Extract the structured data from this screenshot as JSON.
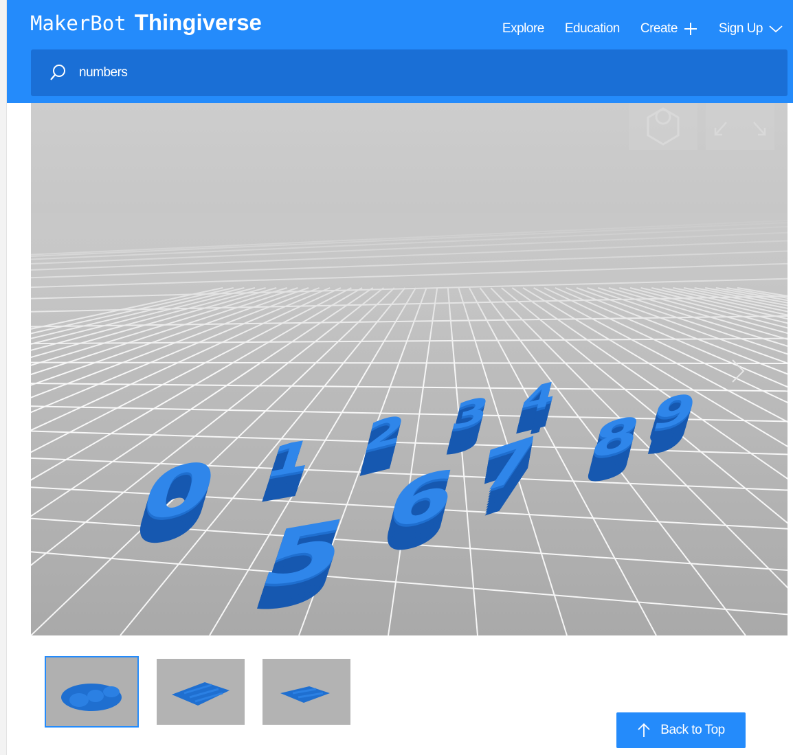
{
  "brand": {
    "maker": "MakerBot",
    "name": "Thingiverse"
  },
  "nav": {
    "explore": "Explore",
    "education": "Education",
    "create": "Create",
    "signup": "Sign Up"
  },
  "search": {
    "value": "numbers"
  },
  "viewer": {
    "digits": [
      "0",
      "1",
      "2",
      "3",
      "4",
      "5",
      "6",
      "7",
      "8",
      "9"
    ]
  },
  "back_to_top": "Back to Top",
  "colors": {
    "brand": "#248bfb",
    "search_bg": "#1a6fd6",
    "model": "#1f6fd0"
  },
  "icons": [
    "search-icon",
    "plus-icon",
    "chevron-down-icon",
    "settings-hex-icon",
    "expand-icon",
    "chevron-right-icon",
    "arrow-up-icon"
  ]
}
